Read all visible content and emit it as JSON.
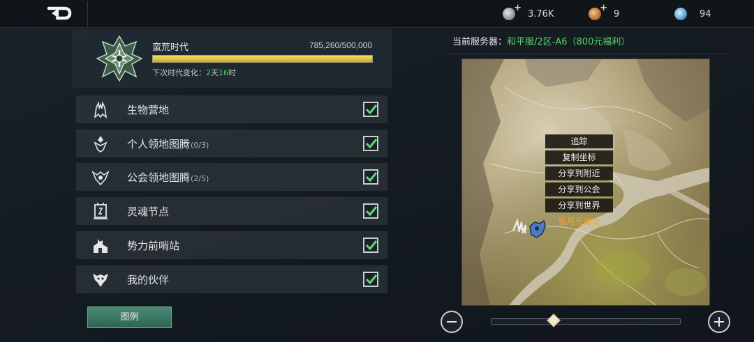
{
  "topbar": {
    "back_icon": "back-arrow-icon",
    "resources": [
      {
        "icon": "silver-coin-icon",
        "value": "3.76K",
        "addable": true
      },
      {
        "icon": "bronze-coin-icon",
        "value": "9",
        "addable": true
      },
      {
        "icon": "crystal-orb-icon",
        "value": "94",
        "addable": false
      }
    ]
  },
  "era": {
    "title": "蛮荒时代",
    "progress_text": "785,260/500,000",
    "progress_fraction": 1.0,
    "next_change_label": "下次时代变化：",
    "days": "2",
    "days_unit": "天",
    "hours": "16",
    "hours_unit": "时"
  },
  "filters": [
    {
      "icon": "creature-camp-icon",
      "label": "生物营地",
      "count": "",
      "checked": true
    },
    {
      "icon": "personal-totem-icon",
      "label": "个人领地图腾",
      "count": "(0/3)",
      "checked": true
    },
    {
      "icon": "guild-totem-icon",
      "label": "公会领地图腾",
      "count": "(2/5)",
      "checked": true
    },
    {
      "icon": "soul-node-icon",
      "label": "灵魂节点",
      "count": "",
      "checked": true
    },
    {
      "icon": "outpost-icon",
      "label": "势力前哨站",
      "count": "",
      "checked": true
    },
    {
      "icon": "partner-icon",
      "label": "我的伙伴",
      "count": "",
      "checked": true
    }
  ],
  "legend_button": "图例",
  "server": {
    "label": "当前服务器：",
    "name": "和平服/2区-A6（800元福利）"
  },
  "context_menu": {
    "items": [
      "追踪",
      "复制坐标",
      "分享到附近",
      "分享到公会",
      "分享到世界"
    ],
    "guild_name": "银月兄弟会"
  },
  "zoom": {
    "level_fraction": 0.33
  },
  "colors": {
    "accent_green": "#5ad36b",
    "guild_orange": "#f0a13a",
    "progress_gold": "#e6cf52"
  }
}
